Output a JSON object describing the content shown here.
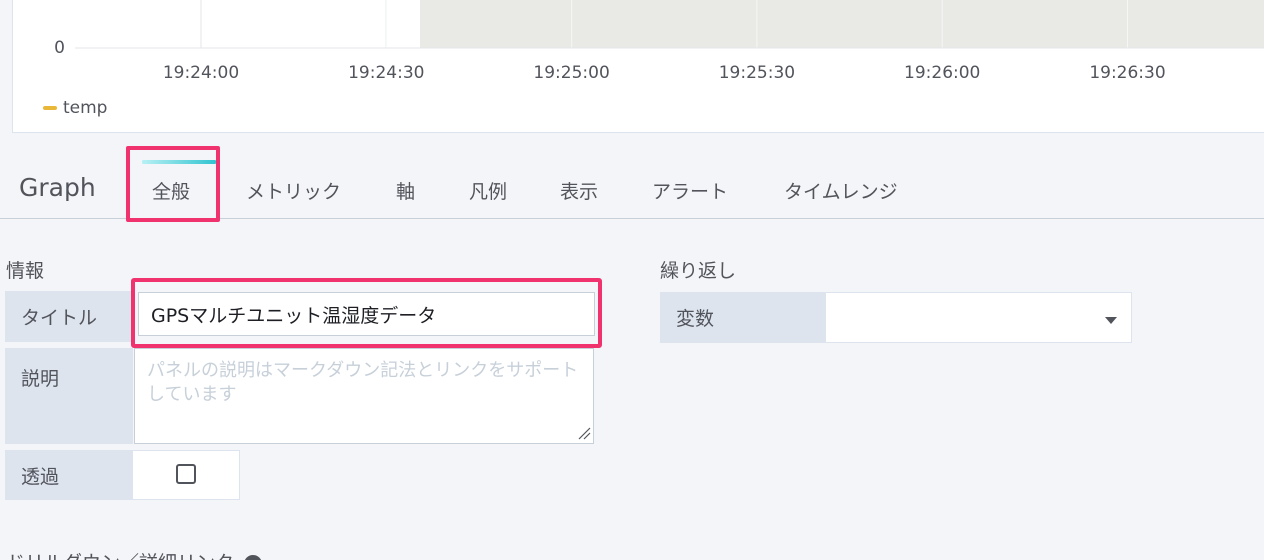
{
  "graph": {
    "y_zero_label": "0",
    "x_ticks": [
      "19:24:00",
      "19:24:30",
      "19:25:00",
      "19:25:30",
      "19:26:00",
      "19:26:30"
    ],
    "legend_label": "temp",
    "series_color": "#eab839"
  },
  "chart_data": {
    "type": "line",
    "x": [
      "19:24:00",
      "19:24:30",
      "19:25:00",
      "19:25:30",
      "19:26:00",
      "19:26:30"
    ],
    "series": [
      {
        "name": "temp",
        "values": []
      }
    ],
    "title": "",
    "xlabel": "",
    "ylabel": "",
    "y_tick_labels": [
      "0"
    ],
    "grid": true,
    "legend": "bottom-left"
  },
  "editor": {
    "title": "Graph",
    "tabs": [
      "全般",
      "メトリック",
      "軸",
      "凡例",
      "表示",
      "アラート",
      "タイムレンジ"
    ],
    "active_tab": "全般",
    "accent_color": "#f0336e"
  },
  "info": {
    "section_title": "情報",
    "title_label": "タイトル",
    "title_value": "GPSマルチユニット温湿度データ",
    "description_label": "説明",
    "description_placeholder": "パネルの説明はマークダウン記法とリンクをサポートしています",
    "transparent_label": "透過",
    "transparent_checked": false
  },
  "repeat": {
    "section_title": "繰り返し",
    "variable_label": "変数",
    "variable_value": ""
  },
  "drilldown": {
    "section_title": "ドリルダウン／詳細リンク"
  }
}
